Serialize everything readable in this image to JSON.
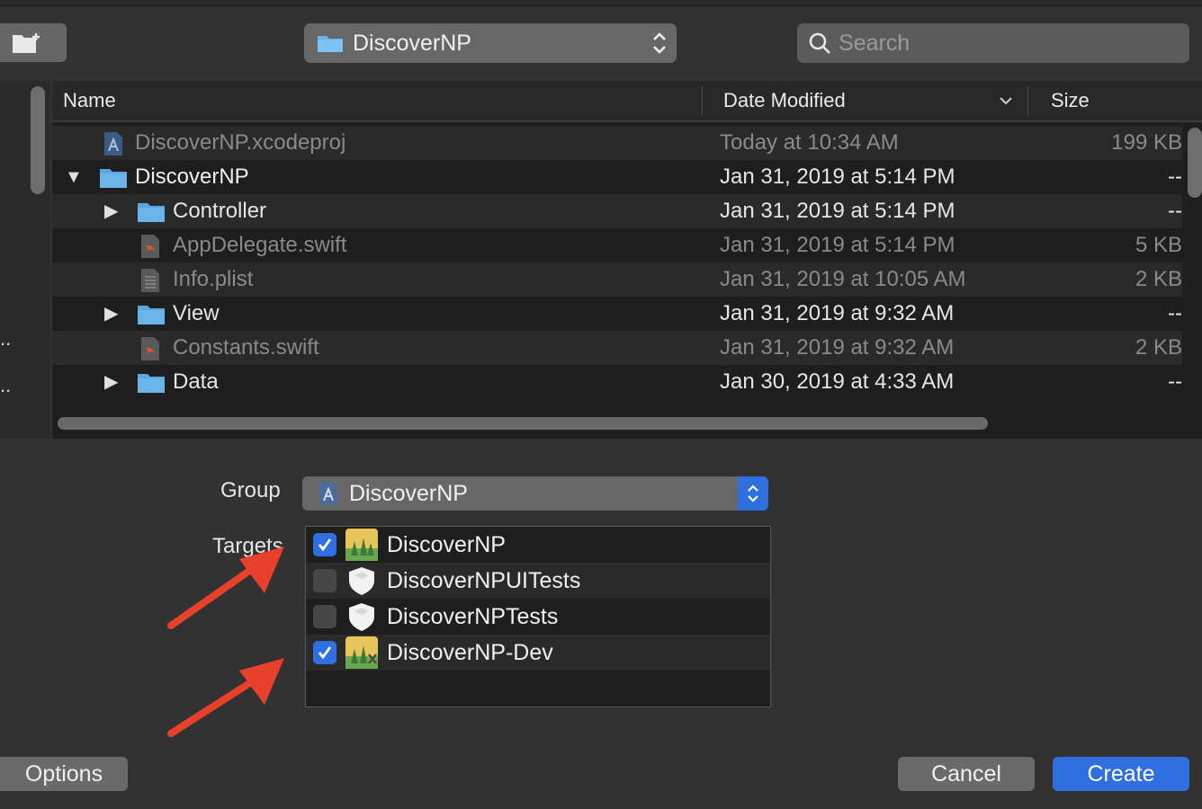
{
  "toolbar": {
    "location": "DiscoverNP",
    "search_placeholder": "Search"
  },
  "columns": {
    "name": "Name",
    "date": "Date Modified",
    "size": "Size"
  },
  "files": [
    {
      "name": "DiscoverNP.xcodeproj",
      "date": "Today at 10:34 AM",
      "size": "199 KB",
      "icon": "xcodeproj-icon",
      "dim": true
    },
    {
      "name": "DiscoverNP",
      "date": "Jan 31, 2019 at 5:14 PM",
      "size": "--",
      "icon": "folder-icon",
      "expanded": true
    },
    {
      "name": "Controller",
      "date": "Jan 31, 2019 at 5:14 PM",
      "size": "--",
      "icon": "folder-icon"
    },
    {
      "name": "AppDelegate.swift",
      "date": "Jan 31, 2019 at 5:14 PM",
      "size": "5 KB",
      "icon": "swift-file-icon",
      "dim": true
    },
    {
      "name": "Info.plist",
      "date": "Jan 31, 2019 at 10:05 AM",
      "size": "2 KB",
      "icon": "plist-file-icon",
      "dim": true
    },
    {
      "name": "View",
      "date": "Jan 31, 2019 at 9:32 AM",
      "size": "--",
      "icon": "folder-icon"
    },
    {
      "name": "Constants.swift",
      "date": "Jan 31, 2019 at 9:32 AM",
      "size": "2 KB",
      "icon": "swift-file-icon",
      "dim": true
    },
    {
      "name": "Data",
      "date": "Jan 30, 2019 at 4:33 AM",
      "size": "--",
      "icon": "folder-icon"
    }
  ],
  "group": {
    "label": "Group",
    "value": "DiscoverNP"
  },
  "targets": {
    "label": "Targets",
    "items": [
      {
        "name": "DiscoverNP",
        "checked": true
      },
      {
        "name": "DiscoverNPUITests",
        "checked": false
      },
      {
        "name": "DiscoverNPTests",
        "checked": false
      },
      {
        "name": "DiscoverNP-Dev",
        "checked": true
      }
    ]
  },
  "buttons": {
    "options": "Options",
    "cancel": "Cancel",
    "create": "Create"
  },
  "colors": {
    "accent": "#2f6fe0",
    "annotation_arrow": "#e8402a",
    "folder": "#6ab4ec"
  }
}
